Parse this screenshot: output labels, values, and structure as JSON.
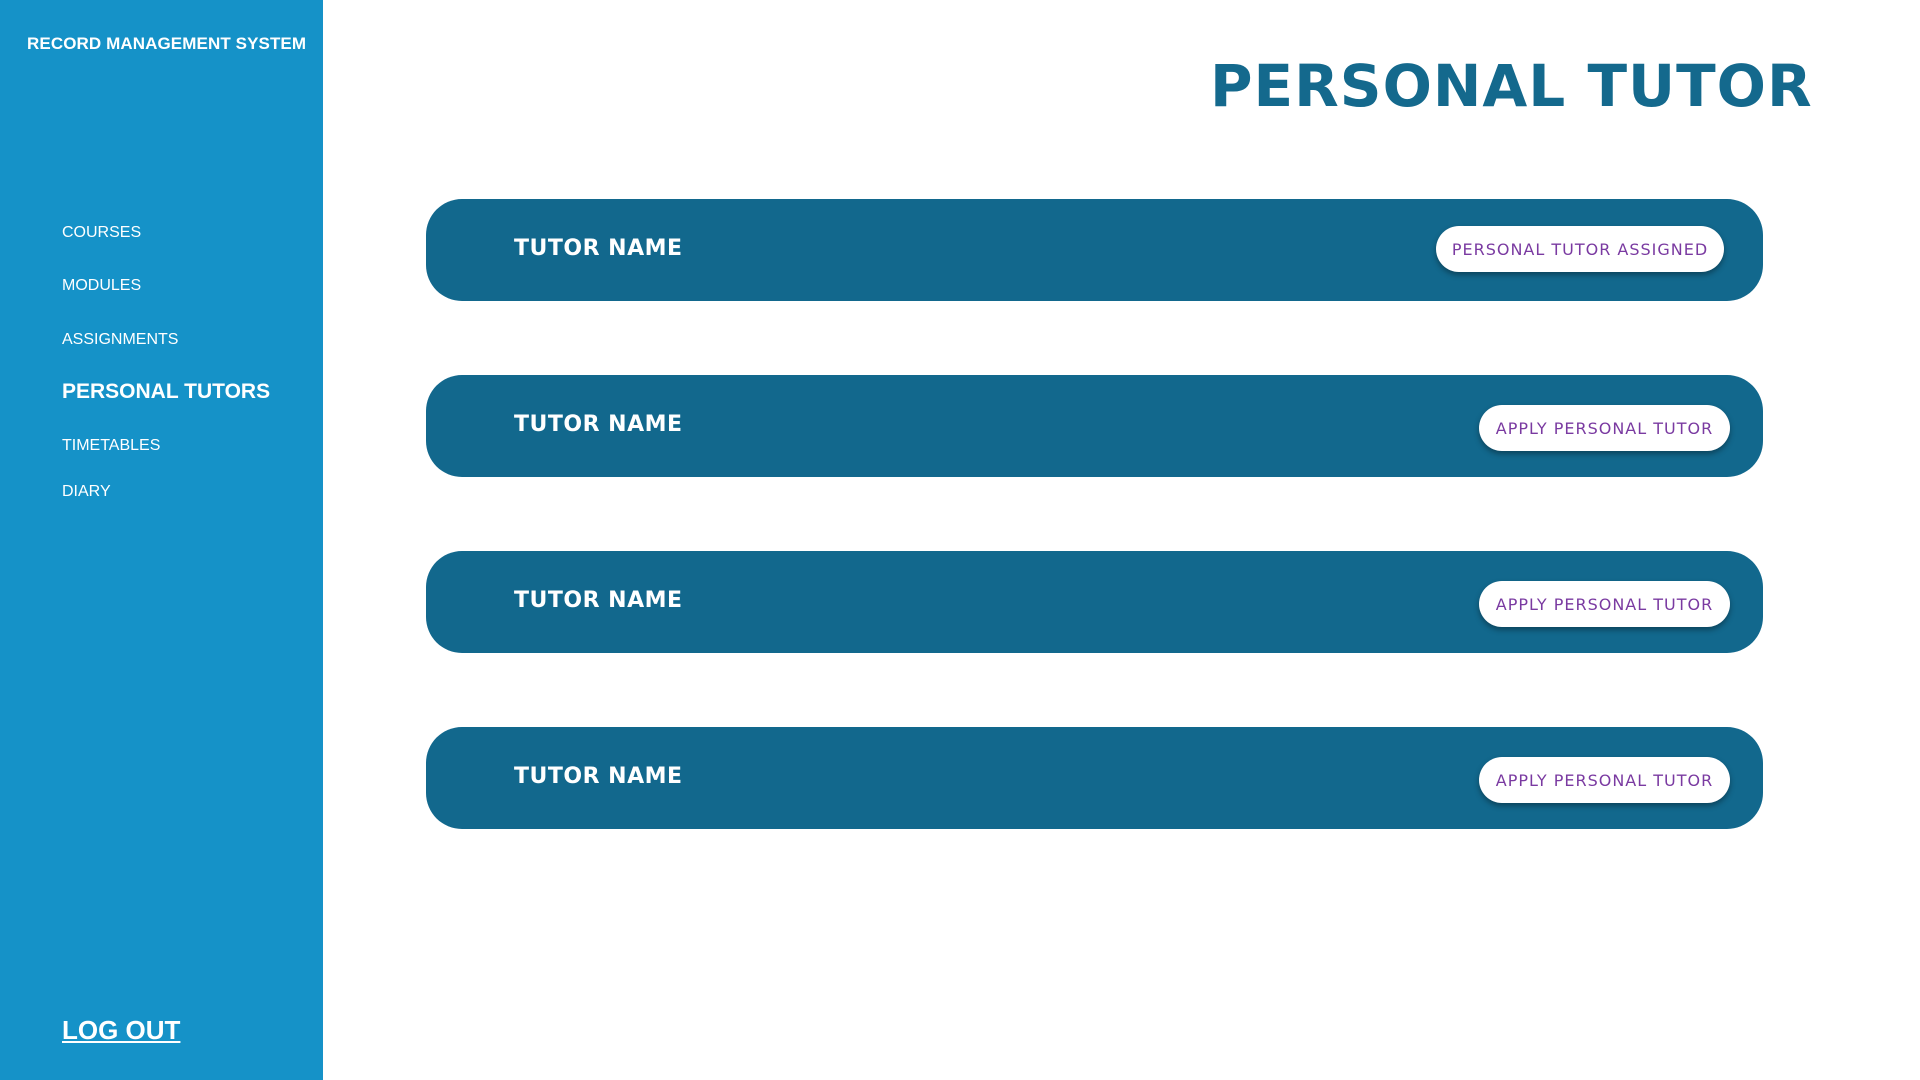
{
  "sidebar": {
    "app_title": "RECORD MANAGEMENT SYSTEM",
    "items": [
      {
        "label": "COURSES",
        "active": false
      },
      {
        "label": "MODULES",
        "active": false
      },
      {
        "label": "ASSIGNMENTS",
        "active": false
      },
      {
        "label": "PERSONAL TUTORS",
        "active": true
      },
      {
        "label": "TIMETABLES",
        "active": false
      },
      {
        "label": "DIARY",
        "active": false
      }
    ],
    "logout_label": "LOG OUT"
  },
  "main": {
    "title": "PERSONAL TUTOR",
    "tutors": [
      {
        "name": "TUTOR NAME",
        "action_label": "PERSONAL TUTOR ASSIGNED"
      },
      {
        "name": "TUTOR NAME",
        "action_label": "APPLY PERSONAL TUTOR"
      },
      {
        "name": "TUTOR NAME",
        "action_label": "APPLY PERSONAL TUTOR"
      },
      {
        "name": "TUTOR NAME",
        "action_label": "APPLY PERSONAL TUTOR"
      }
    ]
  },
  "colors": {
    "sidebar_bg": "#1592c8",
    "card_bg": "#12688d",
    "title_color": "#14698d",
    "button_text": "#7a3aa1"
  }
}
